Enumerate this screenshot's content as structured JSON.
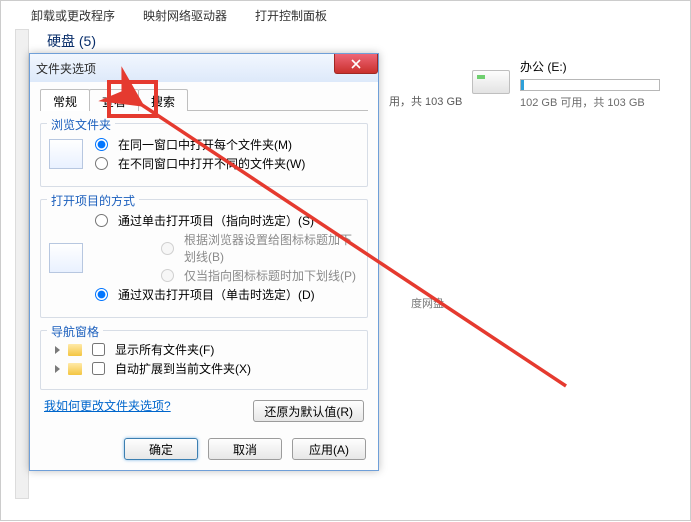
{
  "toplinks": {
    "uninstall": "卸载或更改程序",
    "mapdrive": "映射网络驱动器",
    "opencpl": "打开控制面板"
  },
  "section_title": "硬盘 (5)",
  "drive": {
    "label": "办公 (E:)",
    "status": "102 GB 可用，共 103 GB"
  },
  "bg_status": "用，共 103 GB",
  "bg_cloud": "度网盘",
  "dialog": {
    "title": "文件夹选项",
    "tabs": {
      "general": "常规",
      "view": "查看",
      "search": "搜索"
    },
    "browse": {
      "legend": "浏览文件夹",
      "same": "在同一窗口中打开每个文件夹(M)",
      "diff": "在不同窗口中打开不同的文件夹(W)"
    },
    "open": {
      "legend": "打开项目的方式",
      "single": "通过单击打开项目（指向时选定）(S)",
      "sub1": "根据浏览器设置给图标标题加下划线(B)",
      "sub2": "仅当指向图标标题时加下划线(P)",
      "double": "通过双击打开项目（单击时选定）(D)"
    },
    "nav": {
      "legend": "导航窗格",
      "all": "显示所有文件夹(F)",
      "expand": "自动扩展到当前文件夹(X)"
    },
    "restore": "还原为默认值(R)",
    "help": "我如何更改文件夹选项?",
    "ok": "确定",
    "cancel": "取消",
    "apply": "应用(A)"
  }
}
